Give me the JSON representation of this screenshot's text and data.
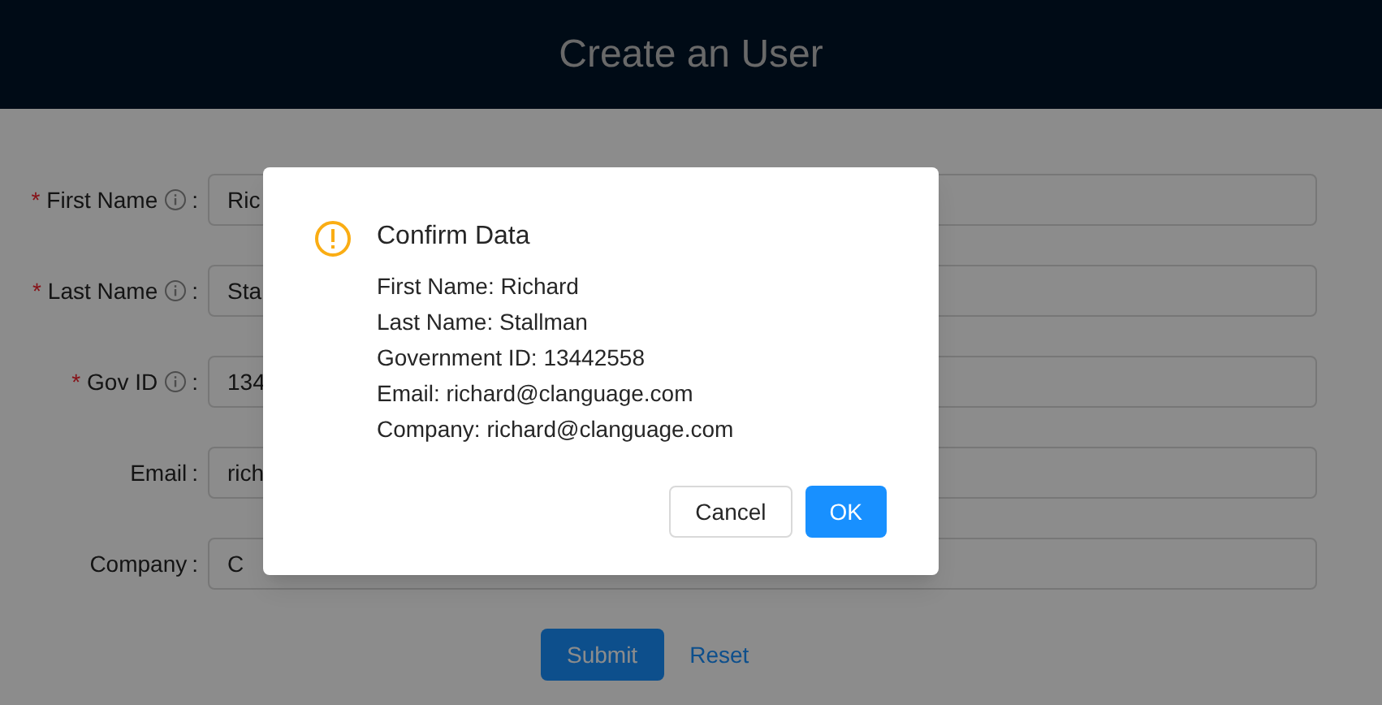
{
  "header": {
    "title": "Create an User"
  },
  "fields": [
    {
      "required_mark": "*",
      "label": "First Name",
      "info": true,
      "colon": ":",
      "value": "Ric"
    },
    {
      "required_mark": "*",
      "label": "Last Name",
      "info": true,
      "colon": ":",
      "value": "Sta"
    },
    {
      "required_mark": "*",
      "label": "Gov ID",
      "info": true,
      "colon": ":",
      "value": "134"
    },
    {
      "label": "Email",
      "info": false,
      "colon": ":",
      "value": "rich"
    },
    {
      "label": "Company",
      "info": false,
      "colon": ":",
      "value": "C"
    }
  ],
  "actions": {
    "submit": "Submit",
    "reset": "Reset"
  },
  "dialog": {
    "title": "Confirm Data",
    "lines": [
      "First Name: Richard",
      "Last Name: Stallman",
      "Government ID: 13442558",
      "Email: richard@clanguage.com",
      "Company: richard@clanguage.com"
    ],
    "cancel": "Cancel",
    "ok": "OK"
  }
}
